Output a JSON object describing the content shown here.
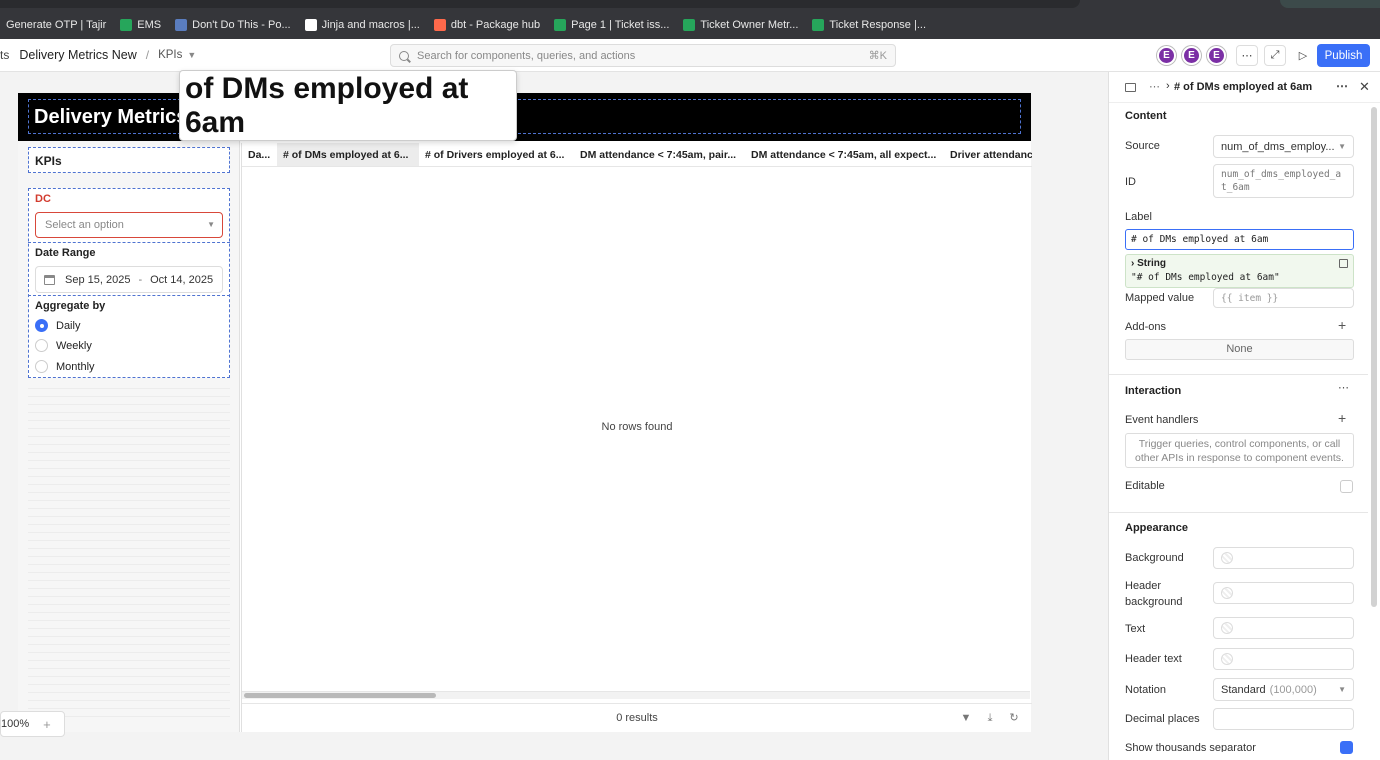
{
  "bookmarks": [
    {
      "label": "Generate OTP | Tajir",
      "color": "#35363a"
    },
    {
      "label": "EMS",
      "color": "#26a65b"
    },
    {
      "label": "Don't Do This - Po...",
      "color": "#5a7dbf"
    },
    {
      "label": "Jinja and macros |...",
      "color": "#ffffff"
    },
    {
      "label": "dbt - Package hub",
      "color": "#ff694b"
    },
    {
      "label": "Page 1 | Ticket iss...",
      "color": "#26a65b"
    },
    {
      "label": "Ticket Owner Metr...",
      "color": "#26a65b"
    },
    {
      "label": "Ticket Response |...",
      "color": "#26a65b"
    }
  ],
  "header": {
    "crumb_cut": "ts",
    "app_name": "Delivery Metrics New",
    "page_name": "KPIs",
    "search_placeholder": "Search for components, queries, and actions",
    "search_shortcut": "⌘K",
    "avatars": [
      "E",
      "E",
      "E"
    ],
    "publish_label": "Publish"
  },
  "canvas": {
    "hero_title": "Delivery Metrics",
    "kpi_title": "KPIs",
    "dc_label": "DC",
    "dc_placeholder": "Select an option",
    "date_range_label": "Date Range",
    "date_start": "Sep 15, 2025",
    "date_sep": "-",
    "date_end": "Oct 14, 2025",
    "aggregate_label": "Aggregate by",
    "aggregate_options": [
      {
        "label": "Daily",
        "selected": true
      },
      {
        "label": "Weekly",
        "selected": false
      },
      {
        "label": "Monthly",
        "selected": false
      }
    ],
    "table_columns": [
      "Da...",
      "# of DMs employed at 6...",
      "# of Drivers employed at 6...",
      "DM attendance < 7:45am, pair...",
      "DM attendance < 7:45am, all expect...",
      "Driver attendanc"
    ],
    "empty_text": "No rows found",
    "results_text": "0 results",
    "zoom_label": "100%",
    "tooltip_text": "of DMs employed at 6am"
  },
  "inspector": {
    "title": "# of DMs employed at 6am",
    "content_section": "Content",
    "source_label": "Source",
    "source_value": "num_of_dms_employ...",
    "id_label": "ID",
    "id_value": "num_of_dms_employed_at_6am",
    "label_label": "Label",
    "label_value": "# of DMs employed at 6am",
    "preview_type": "String",
    "preview_value": "\"# of DMs employed at 6am\"",
    "mapped_label": "Mapped value",
    "mapped_placeholder": "{{ item }}",
    "addons_label": "Add-ons",
    "addons_value": "None",
    "interaction_section": "Interaction",
    "event_handlers_label": "Event handlers",
    "event_handlers_hint": "Trigger queries, control components, or call other APIs in response to component events.",
    "editable_label": "Editable",
    "appearance_section": "Appearance",
    "background_label": "Background",
    "header_background_label": "Header background",
    "text_label": "Text",
    "header_text_label": "Header text",
    "notation_label": "Notation",
    "notation_value": "Standard",
    "notation_hint": "(100,000)",
    "decimal_label": "Decimal places",
    "thousands_label": "Show thousands separator"
  }
}
